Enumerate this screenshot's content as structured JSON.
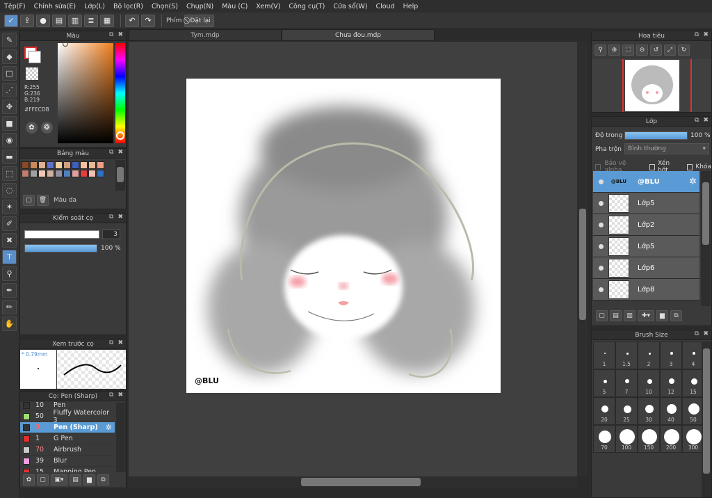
{
  "menu": [
    "Tệp(F)",
    "Chỉnh sửa(E)",
    "Lớp(L)",
    "Bộ lọc(R)",
    "Chọn(S)",
    "Chụp(N)",
    "Màu (C)",
    "Xem(V)",
    "Công cụ(T)",
    "Cửa sổ(W)",
    "Cloud",
    "Help"
  ],
  "toolbar": {
    "phim_label": "Phím",
    "datlai_label": "Đặt lại"
  },
  "tabs": [
    "Tym.mdp",
    "Chưa đou.mdp"
  ],
  "color_panel": {
    "title": "Màu",
    "r": "R:255",
    "g": "G:236",
    "b": "B:219",
    "hex": "#FFECDB"
  },
  "palette_panel": {
    "title": "Bảng màu",
    "label": "Màu da",
    "swatches": [
      "#8a4a2a",
      "#c98a5a",
      "#e0b090",
      "#6070d0",
      "#f0d0a0",
      "#d0a080",
      "#4060c0",
      "#f5c0a0",
      "#e8b898",
      "#f0a080",
      "#c08070",
      "#a0a0a0",
      "#f0c8b0",
      "#d0b0a0",
      "#9090a0",
      "#5080c0",
      "#e0a0a0",
      "#e04040",
      "#f0c0b0",
      "#3070c0"
    ]
  },
  "brush_control": {
    "title": "Kiểm soát cọ",
    "size": "3",
    "opacity": "100 %",
    "opacity_fraction": 1.0
  },
  "brush_preview": {
    "title": "Xem trước cọ",
    "size": "* 0.79mm"
  },
  "brush_list": {
    "title": "Cọ: Pen (Sharp)",
    "items": [
      {
        "n": "10",
        "name": "Pen",
        "color": "#333333"
      },
      {
        "n": "50",
        "name": "Fluffy Watercolor 3",
        "color": "#a0e070"
      },
      {
        "n": "3",
        "name": "Pen (Sharp)",
        "color": "#333333",
        "sel": true
      },
      {
        "n": "1",
        "name": "G Pen",
        "color": "#e03030"
      },
      {
        "n": "70",
        "name": "Airbrush",
        "color": "#cccccc"
      },
      {
        "n": "39",
        "name": "Blur",
        "color": "#f0a0e0"
      },
      {
        "n": "15",
        "name": "Mapping Pen",
        "color": "#e03030"
      }
    ]
  },
  "navigator": {
    "title": "Hoa tiêu"
  },
  "layers": {
    "title": "Lớp",
    "opacity_label": "Độ trong",
    "opacity_value": "100 %",
    "opacity_fraction": 1.0,
    "blend_label": "Pha trộn",
    "blend_value": "Bình thường",
    "alpha_label": "Bảo vệ alpha",
    "clip_label": "Xén bớt",
    "lock_label": "Khóa",
    "items": [
      {
        "name": "@BLU",
        "sel": true,
        "thumb_text": "@BLU"
      },
      {
        "name": "Lớp5"
      },
      {
        "name": "Lớp2"
      },
      {
        "name": "Lớp5"
      },
      {
        "name": "Lớp6"
      },
      {
        "name": "Lớp8"
      }
    ]
  },
  "brush_size": {
    "title": "Brush Size",
    "sizes": [
      "1",
      "1.5",
      "2",
      "3",
      "4",
      "5",
      "7",
      "10",
      "12",
      "15",
      "20",
      "25",
      "30",
      "40",
      "50",
      "70",
      "100",
      "150",
      "200",
      "300"
    ]
  },
  "canvas": {
    "watermark": "@BLU"
  }
}
